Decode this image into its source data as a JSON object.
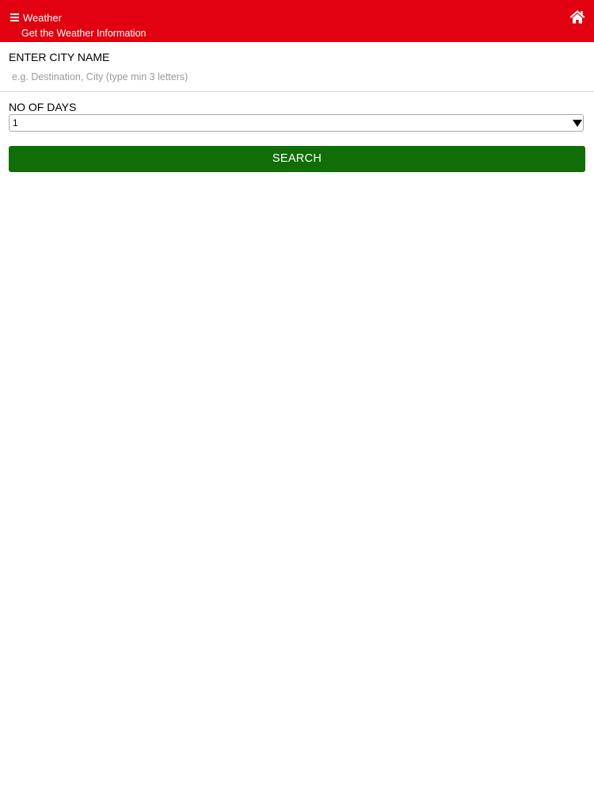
{
  "header": {
    "title": "Weather",
    "subtitle": "Get the Weather Information",
    "menu_icon": "menu-icon",
    "home_icon": "home-icon",
    "background_color": "#e1000f"
  },
  "city": {
    "label": "ENTER CITY NAME",
    "placeholder": "e.g. Destination, City (type min 3 letters)",
    "value": ""
  },
  "days": {
    "label": "NO OF DAYS",
    "selected": "1"
  },
  "search": {
    "label": "SEARCH",
    "color": "#116d08"
  }
}
